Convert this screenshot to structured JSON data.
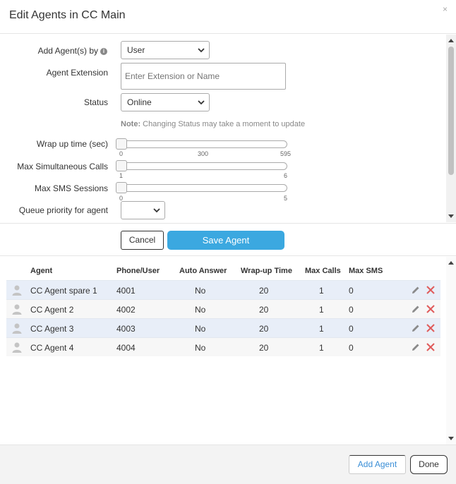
{
  "dialog": {
    "title": "Edit Agents in CC Main",
    "close_symbol": "×"
  },
  "form": {
    "add_by": {
      "label": "Add Agent(s) by",
      "value": "User",
      "info_icon": "i"
    },
    "agent_extension": {
      "label": "Agent Extension",
      "placeholder": "Enter Extension or Name"
    },
    "status": {
      "label": "Status",
      "value": "Online"
    },
    "note": {
      "prefix": "Note:",
      "text": " Changing Status may take a moment to update"
    },
    "wrap_up": {
      "label": "Wrap up time (sec)",
      "ticks": [
        "0",
        "300",
        "595"
      ],
      "value": 0
    },
    "max_calls": {
      "label": "Max Simultaneous Calls",
      "ticks": [
        "1",
        "6"
      ],
      "value": 1
    },
    "max_sms": {
      "label": "Max SMS Sessions",
      "ticks": [
        "0",
        "5"
      ],
      "value": 0
    },
    "queue_priority": {
      "label": "Queue priority for agent",
      "value": ""
    }
  },
  "buttons": {
    "cancel": "Cancel",
    "save": "Save Agent",
    "add_agent": "Add Agent",
    "done": "Done"
  },
  "table": {
    "headers": [
      "Agent",
      "Phone/User",
      "Auto Answer",
      "Wrap-up Time",
      "Max Calls",
      "Max SMS"
    ],
    "rows": [
      {
        "agent": "CC Agent spare 1",
        "phone": "4001",
        "auto_answer": "No",
        "wrap_up": "20",
        "max_calls": "1",
        "max_sms": "0"
      },
      {
        "agent": "CC Agent 2",
        "phone": "4002",
        "auto_answer": "No",
        "wrap_up": "20",
        "max_calls": "1",
        "max_sms": "0"
      },
      {
        "agent": "CC Agent 3",
        "phone": "4003",
        "auto_answer": "No",
        "wrap_up": "20",
        "max_calls": "1",
        "max_sms": "0"
      },
      {
        "agent": "CC Agent 4",
        "phone": "4004",
        "auto_answer": "No",
        "wrap_up": "20",
        "max_calls": "1",
        "max_sms": "0"
      }
    ]
  },
  "colors": {
    "accent": "#3ba8e0",
    "delete": "#e05a5a",
    "row_highlight": "#e8eef8"
  }
}
